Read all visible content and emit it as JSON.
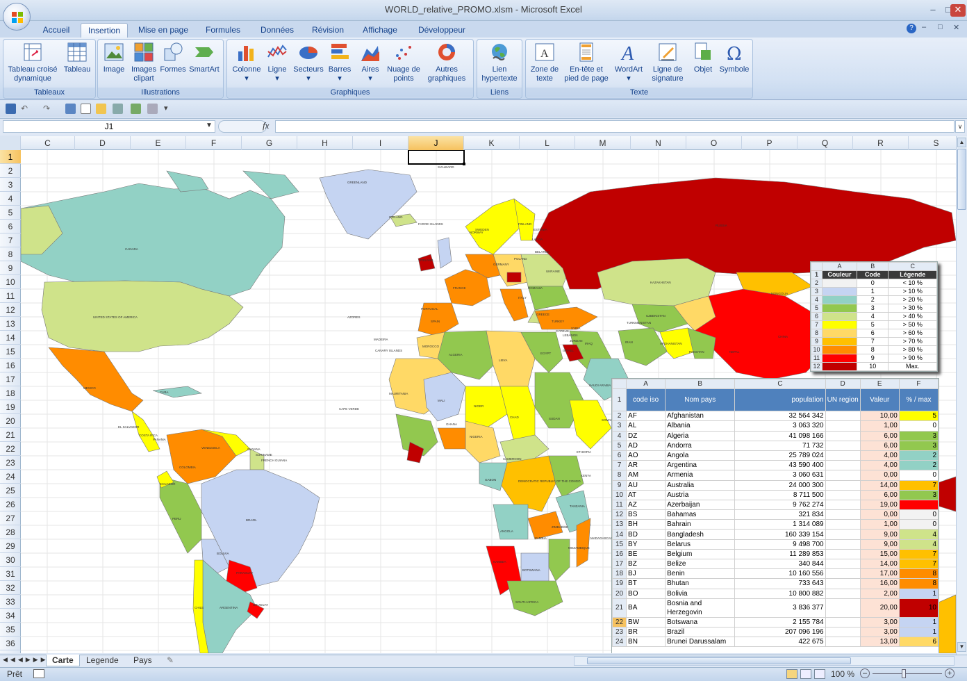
{
  "window": {
    "title": "WORLD_relative_PROMO.xlsm - Microsoft Excel"
  },
  "tabs": [
    "Accueil",
    "Insertion",
    "Mise en page",
    "Formules",
    "Données",
    "Révision",
    "Affichage",
    "Développeur"
  ],
  "active_tab": "Insertion",
  "ribbon": {
    "groups": [
      {
        "label": "Tableaux",
        "buttons": [
          "Tableau croisé dynamique",
          "Tableau"
        ]
      },
      {
        "label": "Illustrations",
        "buttons": [
          "Image",
          "Images clipart",
          "Formes",
          "SmartArt"
        ]
      },
      {
        "label": "Graphiques",
        "buttons": [
          "Colonne",
          "Ligne",
          "Secteurs",
          "Barres",
          "Aires",
          "Nuage de points",
          "Autres graphiques"
        ]
      },
      {
        "label": "Liens",
        "buttons": [
          "Lien hypertexte"
        ]
      },
      {
        "label": "Texte",
        "buttons": [
          "Zone de texte",
          "En-tête et pied de page",
          "WordArt",
          "Ligne de signature",
          "Objet",
          "Symbole"
        ]
      }
    ]
  },
  "formula": {
    "name_box": "J1",
    "fx": "fx",
    "content": ""
  },
  "columns": [
    "C",
    "D",
    "E",
    "F",
    "G",
    "H",
    "I",
    "J",
    "K",
    "L",
    "M",
    "N",
    "O",
    "P",
    "Q",
    "R",
    "S"
  ],
  "selected_column": "J",
  "rows": [
    "1",
    "2",
    "3",
    "4",
    "5",
    "6",
    "7",
    "8",
    "9",
    "10",
    "11",
    "12",
    "13",
    "14",
    "15",
    "16",
    "17",
    "18",
    "19",
    "20",
    "21",
    "22",
    "23",
    "24",
    "25",
    "26",
    "27",
    "28",
    "29",
    "30",
    "31",
    "32",
    "33",
    "34",
    "35",
    "36"
  ],
  "selected_row": "1",
  "map_labels": [
    "GREENLAND",
    "CANADA",
    "UNITED STATES OF AMERICA",
    "MEXICO",
    "RUSSIA",
    "KAZAKHSTAN",
    "CHINA",
    "MONGOLIA",
    "BRAZIL",
    "ARGENTINA",
    "ALGERIA",
    "LIBYA",
    "EGYPT",
    "NIGER",
    "CHAD",
    "SUDAN",
    "MALI",
    "ETHIOPIA",
    "DEMOCRATIC REPUBLIC OF THE CONGO",
    "ANGOLA",
    "NAMIBIA",
    "BOTSWANA",
    "SOUTH AFRICA",
    "ZAMBIA",
    "TURKEY",
    "SPAIN",
    "FRANCE",
    "SAUDI ARABIA",
    "AFGHANISTAN",
    "PERU",
    "BOLIVIA",
    "COLOMBIA",
    "VENEZUELA",
    "NIGERIA",
    "MOROCCO",
    "IRAN",
    "UZBEKISTAN",
    "TURKMENISTAN",
    "PAKISTAN",
    "SWEDEN",
    "NORWAY",
    "FINLAND",
    "UKRAINE",
    "POLAND",
    "GERMANY",
    "ITALY",
    "ROMANIA",
    "AZORES",
    "CANARY ISLANDS",
    "MADEIRA",
    "CAPE VERDE",
    "CUBA",
    "KENYA",
    "TANZANIA",
    "MAURITANIA",
    "CAMEROON",
    "GABON",
    "MADAGASCAR",
    "ZIMBABWE",
    "MOZAMBIQUE",
    "CHILE",
    "PARAGUAY",
    "URUGUAY",
    "ECUADOR",
    "GUYANA",
    "SURINAME",
    "FRENCH GUIANA",
    "EL SALVADOR",
    "COSTA RICA",
    "PANAMA",
    "GHANA",
    "NEPAL",
    "SOMALIA",
    "IRELAND",
    "ICELAND",
    "FAROE ISLANDS",
    "SVALBARD",
    "ESTONIA",
    "LATVIA",
    "BELARUS",
    "PORTUGAL",
    "GREECE",
    "CYPRUS",
    "SYRIA",
    "IRAQ",
    "JORDAN",
    "ISRAEL",
    "LEBANON"
  ],
  "legend_table": {
    "col_headers": [
      "A",
      "B",
      "C"
    ],
    "headers": [
      "Couleur",
      "Code",
      "Légende"
    ],
    "rows": [
      {
        "code": "0",
        "label": "< 10 %",
        "color": "#f2f2f2"
      },
      {
        "code": "1",
        "label": "> 10 %",
        "color": "#c5d4f2"
      },
      {
        "code": "2",
        "label": "> 20 %",
        "color": "#92d1c5"
      },
      {
        "code": "3",
        "label": "> 30 %",
        "color": "#92c84f"
      },
      {
        "code": "4",
        "label": "> 40 %",
        "color": "#cfe38a"
      },
      {
        "code": "5",
        "label": "> 50 %",
        "color": "#ffff00"
      },
      {
        "code": "6",
        "label": "> 60 %",
        "color": "#ffd966"
      },
      {
        "code": "7",
        "label": "> 70 %",
        "color": "#ffc000"
      },
      {
        "code": "8",
        "label": "> 80 %",
        "color": "#ff8c00"
      },
      {
        "code": "9",
        "label": "> 90 %",
        "color": "#ff0000"
      },
      {
        "code": "10",
        "label": "Max.",
        "color": "#c00000"
      }
    ]
  },
  "data_table": {
    "col_headers": [
      "A",
      "B",
      "C",
      "D",
      "E",
      "F"
    ],
    "headers": [
      "code iso",
      "Nom pays",
      "population",
      "UN region",
      "Valeur",
      "% / max"
    ],
    "rows": [
      {
        "iso": "AF",
        "name": "Afghanistan",
        "pop": "32 564 342",
        "val": "10,00",
        "pct": "5",
        "color": "#ffff00"
      },
      {
        "iso": "AL",
        "name": "Albania",
        "pop": "3 063 320",
        "val": "1,00",
        "pct": "0",
        "color": "#ffffff"
      },
      {
        "iso": "DZ",
        "name": "Algeria",
        "pop": "41 098 166",
        "val": "6,00",
        "pct": "3",
        "color": "#92c84f"
      },
      {
        "iso": "AD",
        "name": "Andorra",
        "pop": "71 732",
        "val": "6,00",
        "pct": "3",
        "color": "#92c84f"
      },
      {
        "iso": "AO",
        "name": "Angola",
        "pop": "25 789 024",
        "val": "4,00",
        "pct": "2",
        "color": "#92d1c5"
      },
      {
        "iso": "AR",
        "name": "Argentina",
        "pop": "43 590 400",
        "val": "4,00",
        "pct": "2",
        "color": "#92d1c5"
      },
      {
        "iso": "AM",
        "name": "Armenia",
        "pop": "3 060 631",
        "val": "0,00",
        "pct": "0",
        "color": "#ffffff"
      },
      {
        "iso": "AU",
        "name": "Australia",
        "pop": "24 000 300",
        "val": "14,00",
        "pct": "7",
        "color": "#ffc000"
      },
      {
        "iso": "AT",
        "name": "Austria",
        "pop": "8 711 500",
        "val": "6,00",
        "pct": "3",
        "color": "#92c84f"
      },
      {
        "iso": "AZ",
        "name": "Azerbaijan",
        "pop": "9 762 274",
        "val": "19,00",
        "pct": "",
        "color": "#ff0000"
      },
      {
        "iso": "BS",
        "name": "Bahamas",
        "pop": "321 834",
        "val": "0,00",
        "pct": "0",
        "color": "#f2f2f2"
      },
      {
        "iso": "BH",
        "name": "Bahrain",
        "pop": "1 314 089",
        "val": "1,00",
        "pct": "0",
        "color": "#f2f2f2"
      },
      {
        "iso": "BD",
        "name": "Bangladesh",
        "pop": "160 339 154",
        "val": "9,00",
        "pct": "4",
        "color": "#cfe38a"
      },
      {
        "iso": "BY",
        "name": "Belarus",
        "pop": "9 498 700",
        "val": "9,00",
        "pct": "4",
        "color": "#cfe38a"
      },
      {
        "iso": "BE",
        "name": "Belgium",
        "pop": "11 289 853",
        "val": "15,00",
        "pct": "7",
        "color": "#ffc000"
      },
      {
        "iso": "BZ",
        "name": "Belize",
        "pop": "340 844",
        "val": "14,00",
        "pct": "7",
        "color": "#ffc000"
      },
      {
        "iso": "BJ",
        "name": "Benin",
        "pop": "10 160 556",
        "val": "17,00",
        "pct": "8",
        "color": "#ff8c00"
      },
      {
        "iso": "BT",
        "name": "Bhutan",
        "pop": "733 643",
        "val": "16,00",
        "pct": "8",
        "color": "#ff8c00"
      },
      {
        "iso": "BO",
        "name": "Bolivia",
        "pop": "10 800 882",
        "val": "2,00",
        "pct": "1",
        "color": "#c5d4f2"
      },
      {
        "iso": "BA",
        "name": "Bosnia and Herzegovin",
        "pop": "3 836 377",
        "val": "20,00",
        "pct": "10",
        "color": "#c00000"
      },
      {
        "iso": "BW",
        "name": "Botswana",
        "pop": "2 155 784",
        "val": "3,00",
        "pct": "1",
        "color": "#c5d4f2"
      },
      {
        "iso": "BR",
        "name": "Brazil",
        "pop": "207 096 196",
        "val": "3,00",
        "pct": "1",
        "color": "#c5d4f2"
      },
      {
        "iso": "BN",
        "name": "Brunei Darussalam",
        "pop": "422 675",
        "val": "13,00",
        "pct": "6",
        "color": "#ffd966"
      }
    ]
  },
  "sheet_tabs": [
    "Carte",
    "Legende",
    "Pays"
  ],
  "active_sheet": "Carte",
  "status": {
    "ready": "Prêt",
    "zoom": "100 %"
  }
}
